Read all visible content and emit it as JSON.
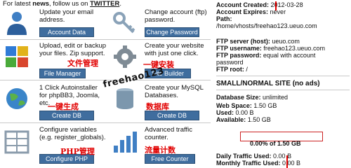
{
  "header": {
    "prefix": "For latest ",
    "news": "news",
    "middle": ", follow us on ",
    "twitter": "TWITTER",
    "suffix": "."
  },
  "tiles": [
    {
      "desc": "Update your email address.",
      "button": "Account Data",
      "icon": "person-icon",
      "cn": ""
    },
    {
      "desc": "Change account (ftp) password.",
      "button": "Change Password",
      "icon": "key-icon",
      "cn": ""
    },
    {
      "desc": "Upload, edit or backup your files. Zip support.",
      "button": "File Manager",
      "icon": "puzzle-icon",
      "cn": "文件管理"
    },
    {
      "desc": "Create your website with just one click.",
      "button": "Site Builder",
      "icon": "gear-icon",
      "cn": "一键安装"
    },
    {
      "desc": "1 Click Autoinstaller for phpBB3, Joomla, etc.",
      "button": "Create DB",
      "icon": "globe-icon",
      "cn": "一键生成"
    },
    {
      "desc": "Create your MySQL Databases.",
      "button": "Create DB",
      "icon": "database-icon",
      "cn": "数据库"
    },
    {
      "desc": "Configure variables (e.g. register_globals).",
      "button": "Configure PHP",
      "icon": "settings-grid-icon",
      "cn": "PHP管理"
    },
    {
      "desc": "Advanced traffic counter.",
      "button": "Free Counter",
      "icon": "counter-icon",
      "cn": "流量计数"
    }
  ],
  "watermark": "freehao123",
  "account": {
    "created_label": "Account Created:",
    "created_value": "2012-03-28",
    "expires_label": "Account Expires:",
    "expires_value": "never",
    "path_label": "Path:",
    "path_value": "/home/vhosts/freehao123.ueuo.com",
    "ftp_server_label": "FTP server (host):",
    "ftp_server_value": "ueuo.com",
    "ftp_user_label": "FTP username:",
    "ftp_user_value": "freehao123.ueuo.com",
    "ftp_pass_label": "FTP password:",
    "ftp_pass_value": "equal with account",
    "ftp_pass_value2": "password",
    "ftp_root_label": "FTP root:",
    "ftp_root_value": "/"
  },
  "site": {
    "heading": "SMALL/NORMAL SITE (no ads)",
    "db_size_label": "Database Size:",
    "db_size_value": "unlimited",
    "web_space_label": "Web Space:",
    "web_space_value": "1.50 GB",
    "used_label": "Used:",
    "used_value": "0.00 B",
    "available_label": "Available:",
    "available_value": "1.50 GB",
    "disk_percent": 0.0,
    "disk_text": "0.00% of 1.50 GB",
    "daily_label": "Daily Traffic Used:",
    "daily_value": "0.00 B",
    "monthly_label": "Monthly Traffic Used:",
    "monthly_value": "0.00 B"
  },
  "colors": {
    "button_bg": "#3f6d9e",
    "chinese_label": "#e10000",
    "disk_border": "#cc2222"
  }
}
